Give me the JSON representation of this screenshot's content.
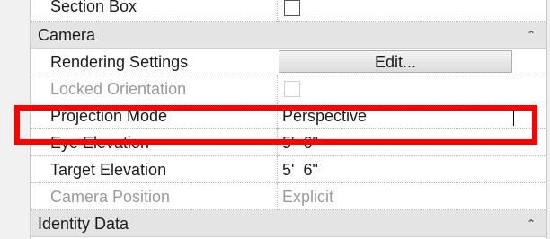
{
  "properties": {
    "section_box": {
      "label": "Section Box",
      "checked": false
    },
    "camera_group": {
      "label": "Camera",
      "toggle_icon": "double-chevron-up"
    },
    "rendering_settings": {
      "label": "Rendering Settings",
      "button_label": "Edit..."
    },
    "locked_orientation": {
      "label": "Locked Orientation",
      "checked": false,
      "disabled": true
    },
    "projection_mode": {
      "label": "Projection Mode",
      "value": "Perspective"
    },
    "eye_elevation": {
      "label": "Eye Elevation",
      "value": "5'  6\""
    },
    "target_elevation": {
      "label": "Target Elevation",
      "value": "5'  6\""
    },
    "camera_position": {
      "label": "Camera Position",
      "value": "Explicit",
      "disabled": true
    },
    "identity_group": {
      "label": "Identity Data",
      "toggle_icon": "double-chevron-up"
    }
  },
  "highlight": {
    "color": "#ff0000",
    "target": "projection_mode"
  }
}
